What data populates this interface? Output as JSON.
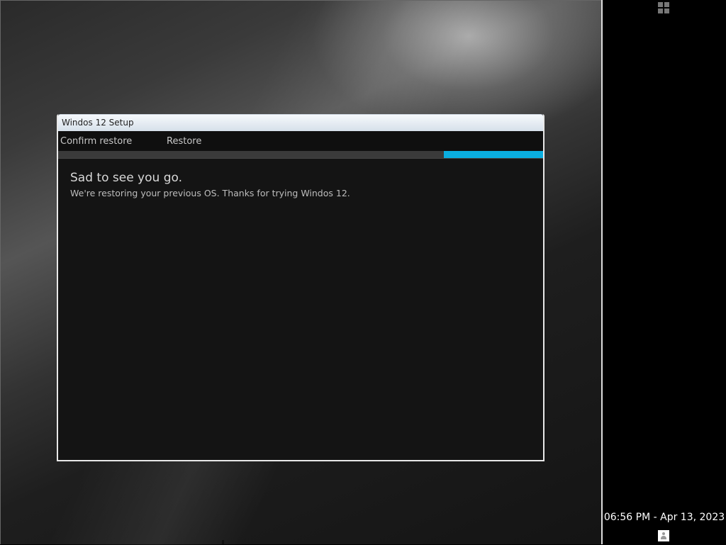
{
  "window": {
    "title": "Windos 12 Setup",
    "steps": [
      "Confirm restore",
      "Restore"
    ],
    "progress_fraction": 0.205,
    "heading": "Sad to see you go.",
    "message": "We're restoring your previous OS. Thanks for trying Windos 12."
  },
  "taskbar": {
    "clock": "06:56 PM - Apr 13, 2023",
    "start_icon": "windows-logo-icon",
    "user_icon": "user-icon"
  },
  "colors": {
    "accent": "#0aaee0",
    "window_bg": "#141414",
    "taskbar_bg": "#000000"
  }
}
